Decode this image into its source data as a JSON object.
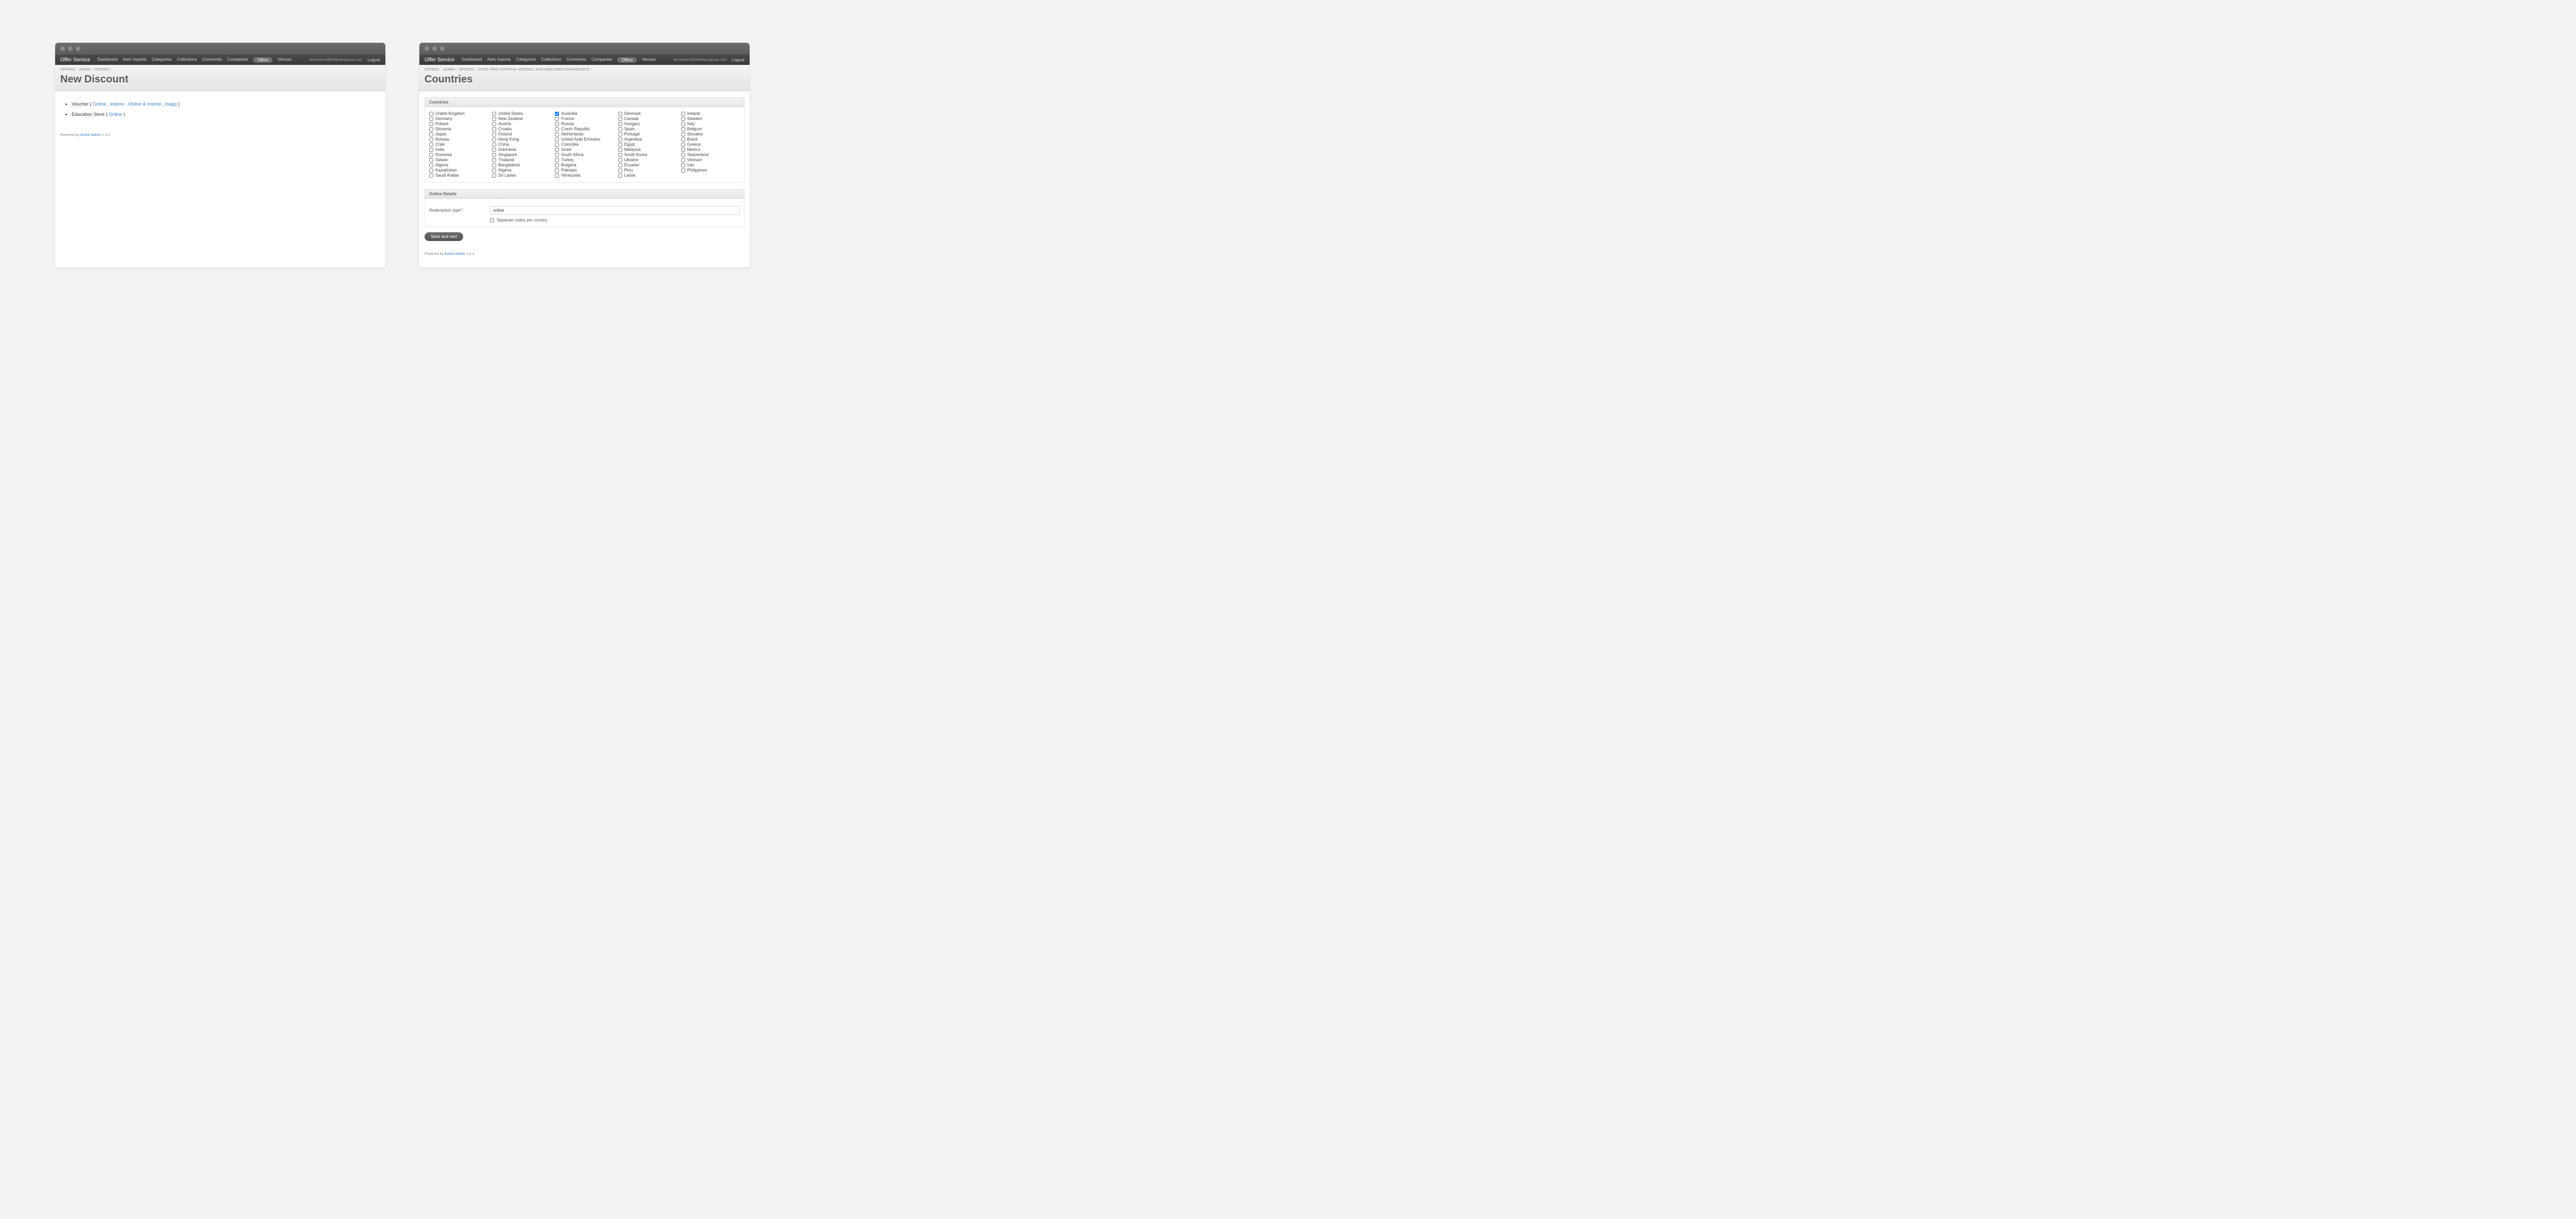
{
  "brand": "Offer Service",
  "nav": {
    "items": [
      "Dashboard",
      "Awin Imports",
      "Categories",
      "Collections",
      "Comments",
      "Companies",
      "Offers",
      "Venues"
    ],
    "active": "Offers",
    "email": "developers@thebeansgroup.com",
    "logout": "Logout"
  },
  "left": {
    "breadcrumbs": [
      "OFFERS",
      "ADMIN",
      "OFFERS"
    ],
    "title": "New Discount",
    "list": [
      {
        "prefix": "Voucher ( ",
        "links": [
          "Online",
          "Instore",
          "Online & Instore",
          "Inapp"
        ],
        "suffix": " )"
      },
      {
        "prefix": "Education Store ( ",
        "links": [
          "Online"
        ],
        "suffix": " )"
      }
    ]
  },
  "right": {
    "breadcrumbs": [
      "OFFERS",
      "ADMIN",
      "OFFERS",
      "CODE FREE SHIPPING 4F855831 3429 45EB B3E8 D59F42B1887E"
    ],
    "title": "Countries",
    "countries_panel_title": "Countries",
    "countries": {
      "col1": [
        "United Kingdom",
        "Germany",
        "Poland",
        "Slovenia",
        "Japan",
        "Norway",
        "Chile",
        "India",
        "Romania",
        "Taiwan",
        "Algeria",
        "Kazakhstan",
        "Saudi Arabia"
      ],
      "col2": [
        "United States",
        "New Zealand",
        "Austria",
        "Croatia",
        "Finland",
        "Hong Kong",
        "China",
        "Indonesia",
        "Singapore",
        "Thailand",
        "Bangladesh",
        "Nigeria",
        "Sri Lanka"
      ],
      "col3": [
        "Australia",
        "France",
        "Russia",
        "Czech Republic",
        "Netherlands",
        "United Arab Emirates",
        "Colombia",
        "Israel",
        "South Africa",
        "Turkey",
        "Bulgaria",
        "Pakistan",
        "Venezuela"
      ],
      "col4": [
        "Denmark",
        "Canada",
        "Hungary",
        "Spain",
        "Portugal",
        "Argentina",
        "Egypt",
        "Malaysia",
        "South Korea",
        "Ukraine",
        "Ecuador",
        "Peru",
        "Latvia"
      ],
      "col5": [
        "Ireland",
        "Sweden",
        "Italy",
        "Belgium",
        "Slovakia",
        "Brazil",
        "Greece",
        "Mexico",
        "Switzerland",
        "Vietnam",
        "Iran",
        "Philippines"
      ]
    },
    "checked": [
      "Australia"
    ],
    "online_details_title": "Online Details",
    "redemption_label": "Redemption type",
    "redemption_value": "online",
    "separate_label": "Separate codes per country",
    "save_label": "Save and next"
  },
  "footer": {
    "powered_by": "Powered by ",
    "active_admin": "Active Admin",
    "version": " 1.4.3"
  }
}
